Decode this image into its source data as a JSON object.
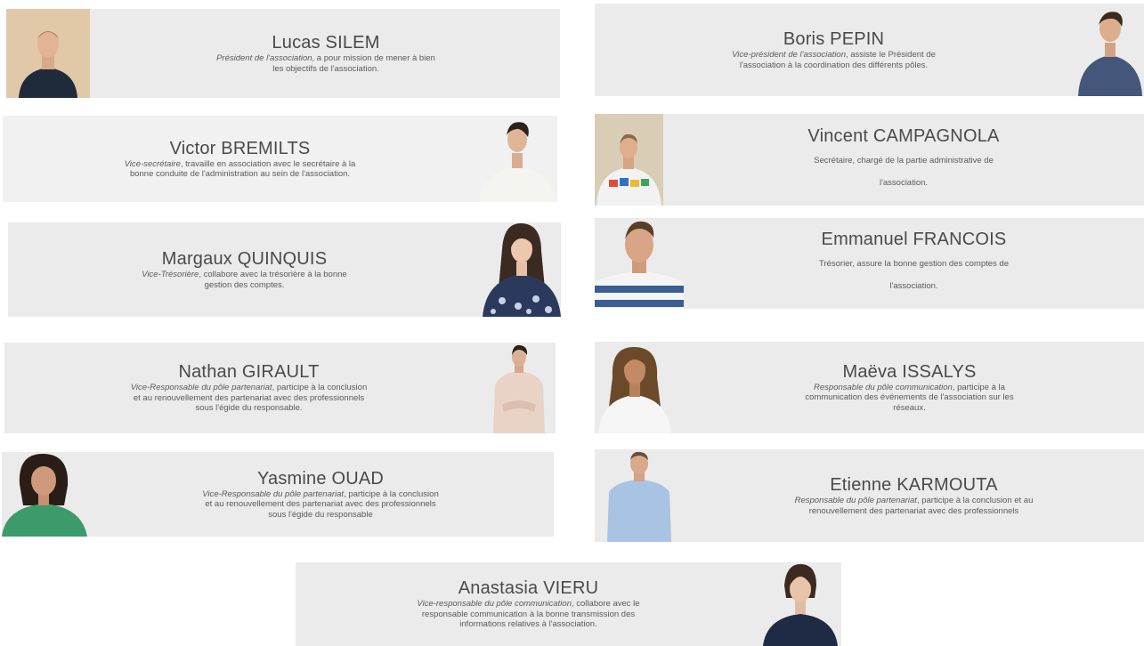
{
  "members": [
    {
      "id": "lucas",
      "name": "Lucas SILEM",
      "role": "Président de l'association",
      "desc": ", a pour mission de mener à bien les objectifs de l'association."
    },
    {
      "id": "boris",
      "name": "Boris PEPIN",
      "role": "Vice-président de l'association",
      "desc": ", assiste le Président de l'association à la coordination des différents pôles."
    },
    {
      "id": "victor",
      "name": "Victor BREMILTS",
      "role": "Vice-secrétaire",
      "desc": ", travaille en association avec le secrétaire à la bonne conduite de l'administration au sein de l'association."
    },
    {
      "id": "vincent",
      "name": "Vincent CAMPAGNOLA",
      "role": "",
      "desc": "Secrétaire, chargé de la partie administrative de l'association."
    },
    {
      "id": "margaux",
      "name": "Margaux QUINQUIS",
      "role": "Vice-Trésorière",
      "desc": ", collabore avec la trésorière à la bonne gestion des comptes."
    },
    {
      "id": "emmanuel",
      "name": "Emmanuel FRANCOIS",
      "role": "",
      "desc": "Trésorier, assure la bonne gestion des comptes de l'association."
    },
    {
      "id": "nathan",
      "name": "Nathan GIRAULT",
      "role": "Vice-Responsable du pôle partenariat",
      "desc": ", participe à la conclusion et au renouvellement des partenariat avec des professionnels sous l'égide du responsable."
    },
    {
      "id": "maeva",
      "name": "Maëva ISSALYS",
      "role": "Responsable du pôle communication",
      "desc": ", participe à la communication des événements de l'association sur les réseaux."
    },
    {
      "id": "yasmine",
      "name": "Yasmine OUAD",
      "role": "Vice-Responsable du pôle partenariat",
      "desc": ", participe à la conclusion et au renouvellement des partenariat avec des professionnels sous l'égide du responsable"
    },
    {
      "id": "etienne",
      "name": "Etienne KARMOUTA",
      "role": "Responsable du pôle partenariat",
      "desc": ", participe à la conclusion et au renouvellement des partenariat avec des professionnels"
    },
    {
      "id": "anastasia",
      "name": "Anastasia VIERU",
      "role": "Vice-responsable du pôle communication",
      "desc": ", collabore avec le responsable communication à la bonne transmission des informations relatives à l'association."
    }
  ],
  "colors": {
    "card_bg": "#ebebeb",
    "name_text": "#4a4a4a",
    "desc_text": "#5a5a5a"
  }
}
